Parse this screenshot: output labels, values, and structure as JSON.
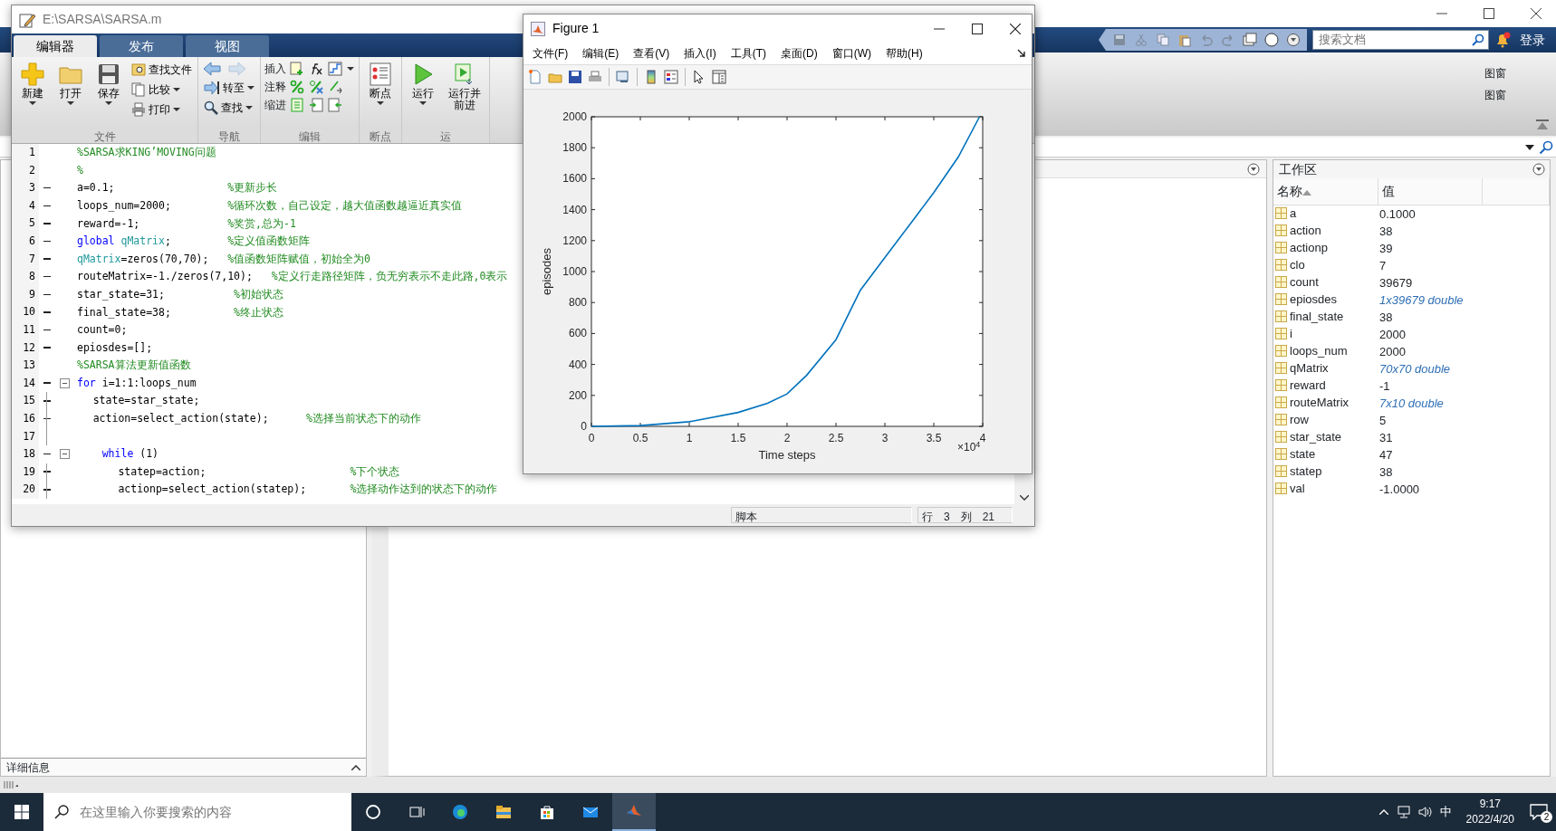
{
  "main_window": {
    "search": {
      "placeholder": "搜索文档"
    },
    "sign_in": "登录",
    "ribbon_fragments": [
      "图窗",
      "图窗"
    ],
    "details_panel": {
      "title": "详细信息"
    },
    "workspace": {
      "title": "工作区",
      "columns": [
        "名称",
        "值"
      ],
      "rows": [
        {
          "name": "a",
          "value": "0.1000",
          "kind": "scalar"
        },
        {
          "name": "action",
          "value": "38",
          "kind": "scalar"
        },
        {
          "name": "actionp",
          "value": "39",
          "kind": "scalar"
        },
        {
          "name": "clo",
          "value": "7",
          "kind": "scalar"
        },
        {
          "name": "count",
          "value": "39679",
          "kind": "scalar"
        },
        {
          "name": "epiosdes",
          "value": "1x39679 double",
          "kind": "array"
        },
        {
          "name": "final_state",
          "value": "38",
          "kind": "scalar"
        },
        {
          "name": "i",
          "value": "2000",
          "kind": "scalar"
        },
        {
          "name": "loops_num",
          "value": "2000",
          "kind": "scalar"
        },
        {
          "name": "qMatrix",
          "value": "70x70 double",
          "kind": "array"
        },
        {
          "name": "reward",
          "value": "-1",
          "kind": "scalar"
        },
        {
          "name": "routeMatrix",
          "value": "7x10 double",
          "kind": "array"
        },
        {
          "name": "row",
          "value": "5",
          "kind": "scalar"
        },
        {
          "name": "star_state",
          "value": "31",
          "kind": "scalar"
        },
        {
          "name": "state",
          "value": "47",
          "kind": "scalar"
        },
        {
          "name": "statep",
          "value": "38",
          "kind": "scalar"
        },
        {
          "name": "val",
          "value": "-1.0000",
          "kind": "scalar"
        }
      ]
    }
  },
  "editor": {
    "title": "E:\\SARSA\\SARSA.m",
    "tabs": [
      {
        "label": "编辑器",
        "selected": true
      },
      {
        "label": "发布",
        "selected": false
      },
      {
        "label": "视图",
        "selected": false
      }
    ],
    "ribbon": {
      "file": {
        "label": "文件",
        "new": "新建",
        "open": "打开",
        "save": "保存",
        "find_files": "查找文件",
        "compare": "比较",
        "print": "打印"
      },
      "navigate": {
        "label": "导航",
        "forward_disabled": true,
        "go_to": "转至",
        "find": "查找"
      },
      "edit": {
        "label": "编辑",
        "insert": "插入",
        "comment": "注释",
        "indent": "缩进"
      },
      "breakpoints": {
        "label": "断点",
        "button": "断点"
      },
      "run": {
        "label": "运",
        "run": "运行",
        "run_advance": "运行并前进"
      }
    },
    "code_lines": [
      {
        "number": "1",
        "executable": false,
        "fold": false,
        "segments": [
          {
            "kind": "comment",
            "text": "%SARSA求KING’MOVING问题"
          }
        ]
      },
      {
        "number": "2",
        "executable": false,
        "fold": false,
        "segments": [
          {
            "kind": "comment",
            "text": "%"
          }
        ]
      },
      {
        "number": "3",
        "executable": true,
        "fold": false,
        "segments": [
          {
            "kind": "code",
            "text": "a=0.1;                  "
          },
          {
            "kind": "comment",
            "text": "%更新步长"
          }
        ]
      },
      {
        "number": "4",
        "executable": true,
        "fold": false,
        "segments": [
          {
            "kind": "code",
            "text": "loops_num=2000;         "
          },
          {
            "kind": "comment",
            "text": "%循环次数，自己设定，越大值函数越逼近真实值"
          }
        ]
      },
      {
        "number": "5",
        "executable": true,
        "fold": false,
        "segments": [
          {
            "kind": "code",
            "text": "reward=-1;              "
          },
          {
            "kind": "comment",
            "text": "%奖赏,总为-1"
          }
        ]
      },
      {
        "number": "6",
        "executable": true,
        "fold": false,
        "segments": [
          {
            "kind": "keyword",
            "text": "global "
          },
          {
            "kind": "variable",
            "text": "qMatrix"
          },
          {
            "kind": "code",
            "text": ";         "
          },
          {
            "kind": "comment",
            "text": "%定义值函数矩阵"
          }
        ]
      },
      {
        "number": "7",
        "executable": true,
        "fold": false,
        "segments": [
          {
            "kind": "variable",
            "text": "qMatrix"
          },
          {
            "kind": "code",
            "text": "=zeros(70,70);   "
          },
          {
            "kind": "comment",
            "text": "%值函数矩阵赋值，初始全为0"
          }
        ]
      },
      {
        "number": "8",
        "executable": true,
        "fold": false,
        "segments": [
          {
            "kind": "code",
            "text": "routeMatrix=-1./zeros(7,10);   "
          },
          {
            "kind": "comment",
            "text": "%定义行走路径矩阵，负无穷表示不走此路,0表示"
          }
        ]
      },
      {
        "number": "9",
        "executable": true,
        "fold": false,
        "segments": [
          {
            "kind": "code",
            "text": "star_state=31;           "
          },
          {
            "kind": "comment",
            "text": "%初始状态"
          }
        ]
      },
      {
        "number": "10",
        "executable": true,
        "fold": false,
        "segments": [
          {
            "kind": "code",
            "text": "final_state=38;          "
          },
          {
            "kind": "comment",
            "text": "%终止状态"
          }
        ]
      },
      {
        "number": "11",
        "executable": true,
        "fold": false,
        "segments": [
          {
            "kind": "code",
            "text": "count=0;"
          }
        ]
      },
      {
        "number": "12",
        "executable": true,
        "fold": false,
        "segments": [
          {
            "kind": "code",
            "text": "epiosdes=[];"
          }
        ]
      },
      {
        "number": "13",
        "executable": false,
        "fold": false,
        "segments": [
          {
            "kind": "comment",
            "text": "%SARSA算法更新值函数"
          }
        ]
      },
      {
        "number": "14",
        "executable": true,
        "fold": true,
        "segments": [
          {
            "kind": "keyword",
            "text": "for"
          },
          {
            "kind": "code",
            "text": " i=1:1:loops_num"
          }
        ]
      },
      {
        "number": "15",
        "executable": true,
        "fold": false,
        "segments": [
          {
            "kind": "code",
            "text": "    state=star_state;"
          }
        ]
      },
      {
        "number": "16",
        "executable": true,
        "fold": false,
        "segments": [
          {
            "kind": "code",
            "text": "    action=select_action(state);      "
          },
          {
            "kind": "comment",
            "text": "%选择当前状态下的动作"
          }
        ]
      },
      {
        "number": "17",
        "executable": false,
        "fold": false
      },
      {
        "number": "18",
        "executable": true,
        "fold": true,
        "segments": [
          {
            "kind": "keyword",
            "text": "    while"
          },
          {
            "kind": "code",
            "text": " (1)"
          }
        ]
      },
      {
        "number": "19",
        "executable": true,
        "fold": false,
        "segments": [
          {
            "kind": "code",
            "text": "        statep=action;                       "
          },
          {
            "kind": "comment",
            "text": "%下个状态"
          }
        ]
      },
      {
        "number": "20",
        "executable": true,
        "fold": false,
        "segments": [
          {
            "kind": "code",
            "text": "        actionp=select_action(statep);       "
          },
          {
            "kind": "comment",
            "text": "%选择动作达到的状态下的动作"
          }
        ]
      }
    ],
    "status": {
      "mode": "脚本",
      "row_label": "行",
      "row": "3",
      "col_label": "列",
      "col": "21"
    }
  },
  "figure": {
    "title": "Figure 1",
    "menu": [
      "文件(F)",
      "编辑(E)",
      "查看(V)",
      "插入(I)",
      "工具(T)",
      "桌面(D)",
      "窗口(W)",
      "帮助(H)"
    ],
    "x_multiplier": "×10$^{4}$",
    "chart_data": {
      "type": "line",
      "xlabel": "Time steps",
      "ylabel": "episodes",
      "xlim": [
        0,
        4
      ],
      "ylim": [
        0,
        2000
      ],
      "xticks": [
        0,
        0.5,
        1,
        1.5,
        2,
        2.5,
        3,
        3.5,
        4
      ],
      "yticks": [
        0,
        200,
        400,
        600,
        800,
        1000,
        1200,
        1400,
        1600,
        1800,
        2000
      ],
      "x": [
        0,
        0.5,
        1,
        1.5,
        1.8,
        2,
        2.2,
        2.5,
        2.75,
        3,
        3.25,
        3.5,
        3.75,
        3.9679
      ],
      "series": [
        {
          "color": "#0072bd",
          "values": [
            0,
            5,
            30,
            90,
            150,
            210,
            330,
            560,
            880,
            1090,
            1300,
            1510,
            1740,
            2000
          ]
        }
      ]
    }
  },
  "taskbar": {
    "search": {
      "placeholder": "在这里输入你要搜索的内容"
    },
    "tray": {
      "ime": "中",
      "time": "9:17",
      "date": "2022/4/20",
      "notifications": "2"
    }
  }
}
